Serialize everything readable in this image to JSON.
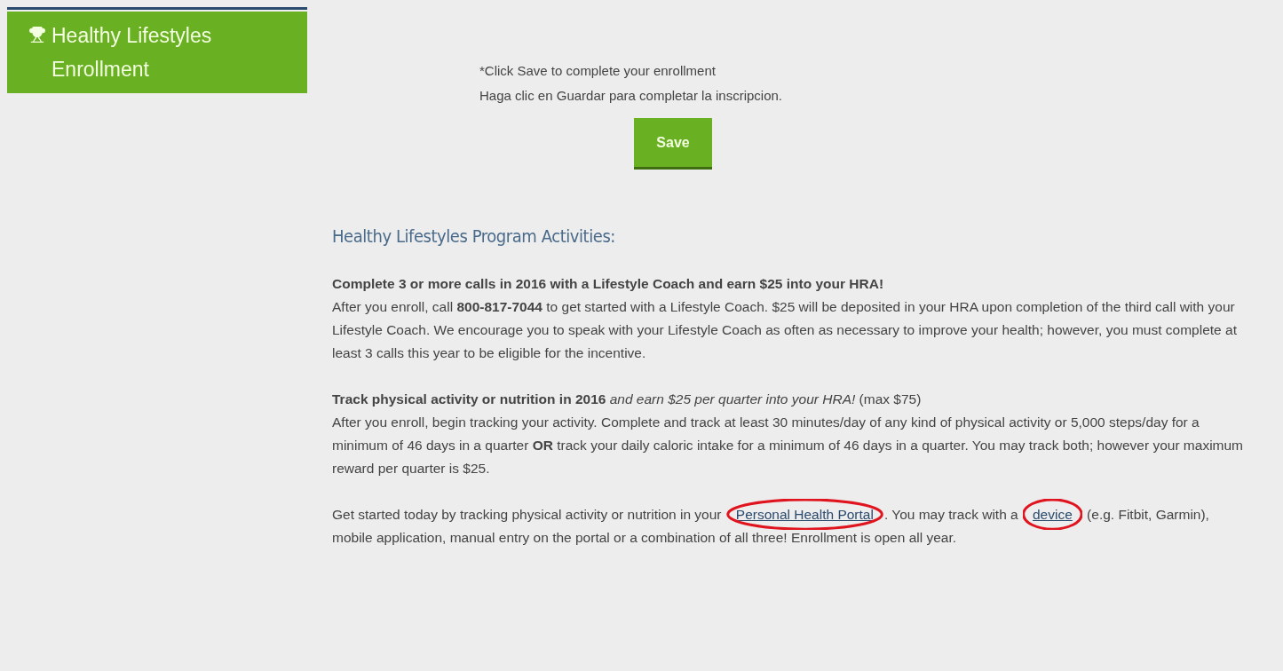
{
  "sidebar": {
    "title": "Healthy Lifestyles Enrollment"
  },
  "instructions": [
    "*Click Save to complete your enrollment",
    "Haga clic en Guardar para completar la inscripcion."
  ],
  "save_button": "Save",
  "heading": "Healthy Lifestyles Program Activities:",
  "sections": [
    {
      "title": "**Complete 3 or more calls in 2016 with a Lifestyle Coach and earn $25 into your HRA!**",
      "body": "After you enroll, call **800-817-7044** to get started with a Lifestyle Coach. $25 will be deposited in your HRA upon completion of the third call with your Lifestyle Coach. We encourage you to speak with your Lifestyle Coach as often as necessary to improve your health; however, you must complete at least 3 calls this year to be eligible for the incentive."
    },
    {
      "title": "**Track physical activity or nutrition in 2016** *and earn $25 per quarter into your HRA!* (max $75)",
      "body": "After you enroll, begin tracking your activity. Complete and track at least 30 minutes/day of any kind of physical activity or 5,000 steps/day for a minimum of 46 days in a quarter **OR** track your daily caloric intake for a minimum of 46 days in a quarter. You may track both; however your maximum reward per quarter is $25."
    }
  ],
  "closing": [
    {
      "kind": "text",
      "text": "Get started today by tracking physical activity or nutrition in your "
    },
    {
      "kind": "link",
      "text": "Personal Health Portal",
      "circled": true
    },
    {
      "kind": "text",
      "text": ". You may track with a "
    },
    {
      "kind": "link",
      "text": "device",
      "circled": true
    },
    {
      "kind": "text",
      "text": " (e.g. Fitbit, Garmin), mobile application, manual entry on the portal or a combination of all three! Enrollment is open all year."
    }
  ]
}
